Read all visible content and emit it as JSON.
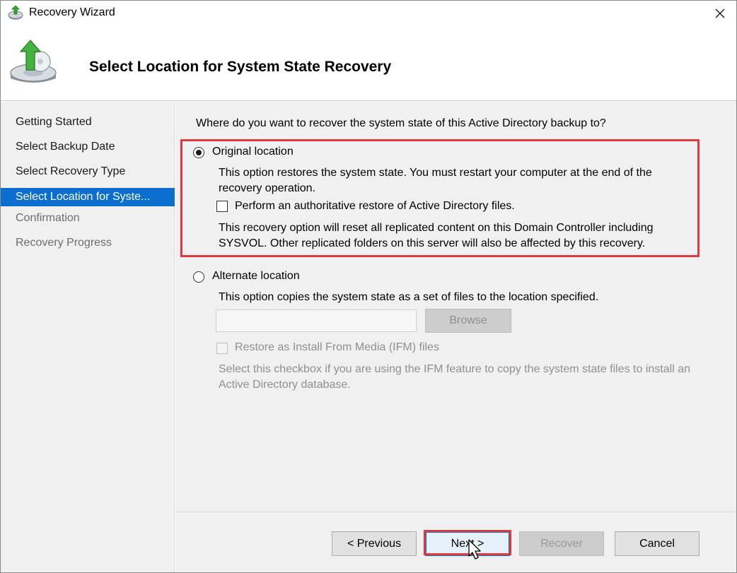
{
  "window": {
    "title": "Recovery Wizard"
  },
  "header": {
    "title": "Select Location for System State Recovery"
  },
  "sidebar": {
    "items": [
      {
        "label": "Getting Started",
        "state": "done"
      },
      {
        "label": "Select Backup Date",
        "state": "done"
      },
      {
        "label": "Select Recovery Type",
        "state": "done"
      },
      {
        "label": "Select Location for Syste...",
        "state": "active"
      },
      {
        "label": "Confirmation",
        "state": "future"
      },
      {
        "label": "Recovery Progress",
        "state": "future"
      }
    ]
  },
  "main": {
    "question": "Where do you want to recover the system state of this Active Directory backup to?",
    "original": {
      "label": "Original location",
      "selected": true,
      "description": "This option restores the system state. You must restart your computer at the end of the recovery operation.",
      "authoritative_label": "Perform an authoritative restore of Active Directory files.",
      "authoritative_checked": false,
      "warning": "This recovery option will reset all replicated content on this Domain Controller including SYSVOL. Other replicated folders on this server will also be affected by this recovery."
    },
    "alternate": {
      "label": "Alternate location",
      "selected": false,
      "description": "This option copies the system state as a set of files to the location specified.",
      "path_value": "",
      "browse_label": "Browse",
      "ifm_label": "Restore as Install From Media (IFM) files",
      "ifm_checked": false,
      "ifm_description": "Select this checkbox if you are using the IFM feature to copy the system state files to install an Active Directory database."
    }
  },
  "footer": {
    "previous_label": "< Previous",
    "next_label": "Next >",
    "recover_label": "Recover",
    "cancel_label": "Cancel"
  },
  "colors": {
    "accent": "#0c6fd0",
    "highlight": "#e0393e",
    "panel": "#f0f0f0"
  },
  "icons": {
    "title": "backup-recovery-icon",
    "header": "recovery-disk-arrow-icon",
    "close": "close-icon",
    "cursor": "mouse-pointer-icon"
  }
}
